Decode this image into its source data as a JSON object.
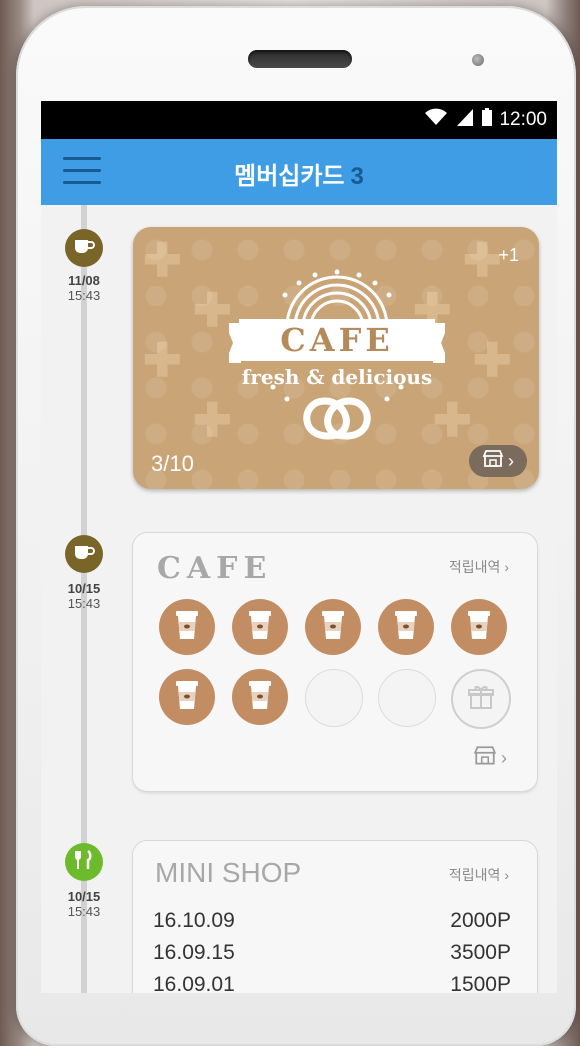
{
  "status_bar": {
    "time": "12:00"
  },
  "app_bar": {
    "title": "멤버십카드",
    "count": "3"
  },
  "timeline": [
    {
      "date": "11/08",
      "time": "15:43",
      "icon": "cup-icon",
      "color": "#7a6528"
    },
    {
      "date": "10/15",
      "time": "15:43",
      "icon": "cup-icon",
      "color": "#7a6528"
    },
    {
      "date": "10/15",
      "time": "15:43",
      "icon": "fork-knife-icon",
      "color": "#6dbb2c"
    }
  ],
  "card1": {
    "logo_title": "CAFE",
    "logo_subtitle": "fresh & delicious",
    "plus": "+1",
    "progress": "3/10",
    "accent": "#c9a476"
  },
  "card2": {
    "title": "CAFE",
    "history_link": "적립내역",
    "stamps_filled": 7,
    "stamps_total": 10,
    "stamp_color": "#c38d63"
  },
  "card3": {
    "title": "MINI SHOP",
    "history_link": "적립내역",
    "records": [
      {
        "date": "16.10.09",
        "points": "2000P"
      },
      {
        "date": "16.09.15",
        "points": "3500P"
      },
      {
        "date": "16.09.01",
        "points": "1500P"
      }
    ]
  }
}
